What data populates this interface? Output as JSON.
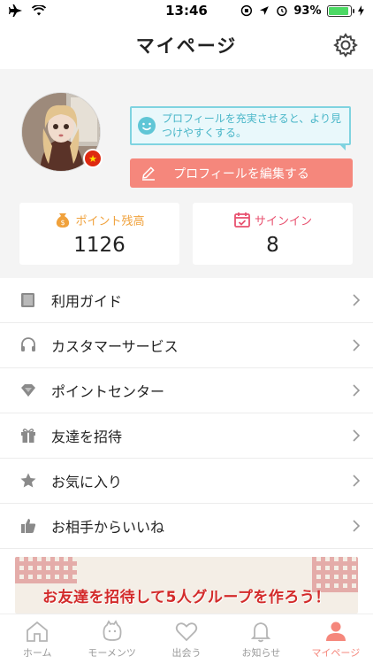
{
  "status_bar": {
    "time": "13:46",
    "battery_percent": "93%",
    "battery_level": 0.93
  },
  "header": {
    "title": "マイページ"
  },
  "profile": {
    "bubble_text": "プロフィールを充実させると、より見つけやすくする。",
    "edit_label": "プロフィールを編集する",
    "points": {
      "label": "ポイント残高",
      "value": "1126"
    },
    "signin": {
      "label": "サインイン",
      "value": "8"
    }
  },
  "menu": [
    {
      "label": "利用ガイド",
      "icon": "book-icon"
    },
    {
      "label": "カスタマーサービス",
      "icon": "headset-icon"
    },
    {
      "label": "ポイントセンター",
      "icon": "diamond-icon"
    },
    {
      "label": "友達を招待",
      "icon": "gift-icon"
    },
    {
      "label": "お気に入り",
      "icon": "star-icon"
    },
    {
      "label": "お相手からいいね",
      "icon": "thumbs-up-icon"
    }
  ],
  "banner": {
    "text": "お友達を招待して5人グループを作ろう！"
  },
  "tabs": [
    {
      "label": "ホーム",
      "icon": "home-icon",
      "active": false
    },
    {
      "label": "モーメンツ",
      "icon": "moments-icon",
      "active": false
    },
    {
      "label": "出会う",
      "icon": "heart-icon",
      "active": false
    },
    {
      "label": "お知らせ",
      "icon": "bell-icon",
      "active": false
    },
    {
      "label": "マイページ",
      "icon": "person-icon",
      "active": true
    }
  ],
  "colors": {
    "accent": "#f5877c",
    "bubble_border": "#7fd3e0",
    "points_orange": "#f0a13b",
    "signin_pink": "#e8516f",
    "tab_inactive": "#9a9a9a"
  }
}
